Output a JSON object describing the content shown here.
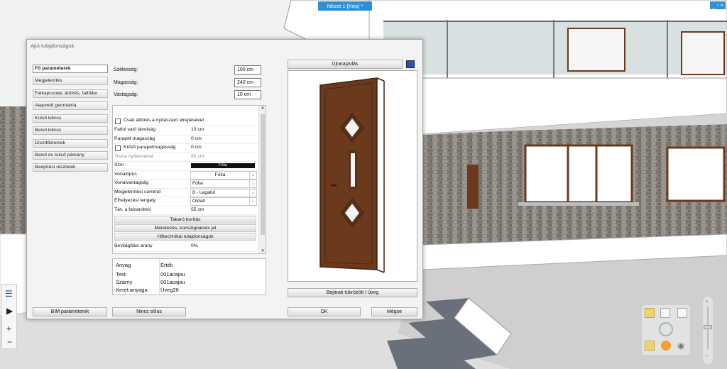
{
  "view_tab": "Nézet 1 [Kép] *",
  "window_controls": "_ ▫ ×",
  "dialog": {
    "title": "Ajtó tulajdonságok",
    "nav": [
      {
        "label": "Fő paraméterek",
        "active": true
      },
      {
        "label": "Megjelenítés"
      },
      {
        "label": "Falkapcsolat, áttörés, falfülke"
      },
      {
        "label": "Alapvető geometria"
      },
      {
        "label": "Külső kilincs"
      },
      {
        "label": "Belső kilincs"
      },
      {
        "label": "Díszítőelemek"
      },
      {
        "label": "Belső és külső párkány"
      },
      {
        "label": "Beépítési részletek"
      }
    ],
    "fields": [
      {
        "label": "Szélesség:",
        "value": "100 cm"
      },
      {
        "label": "Magasság:",
        "value": "240 cm"
      },
      {
        "label": "Vastagság:",
        "value": "10 cm"
      }
    ],
    "grid": {
      "checkbox1": "Csak áttörés a nyílászáró elrejtésével",
      "falto_label": "Faltól való távolság",
      "falto_value": "10 cm",
      "parapet_label": "Parapet magasság",
      "parapet_value": "0 cm",
      "kulso_label": "Külső parapetmagasság",
      "kulso_value": "0 cm",
      "tiszta_label": "Tiszta nyílásméret",
      "tiszta_value": "85 cm",
      "szin_label": "Szín",
      "szin_value": "Fólia",
      "szin_color": "#111111",
      "vonaltipus_label": "Vonaltípus",
      "vonaltipus_value": "Fólia",
      "vonalvastagsag_label": "Vonalvastagság",
      "vonalvastagsag_value": "Fólia",
      "megjsorrend_label": "Megjelenítési sorrend",
      "megjsorrend_value": "8 - Legalul",
      "elhelyezes_label": "Elhelyezési tengely",
      "elhelyezes_value": "Oldalt",
      "tav_label": "Táv. a falsaroktól",
      "tav_value": "55 cm",
      "header1": "Takaró borítás",
      "header2": "Méretezés, konszignációs jel",
      "header3": "Hőtechnikai tulajdonságok",
      "vilagitasi_label": "Bevilágítási arány",
      "vilagitasi_value": "0%"
    },
    "materials": {
      "col1": "Anyag",
      "col2": "Érték",
      "rows": [
        {
          "name": "Test:",
          "value": "001acajou"
        },
        {
          "name": "Szárny",
          "value": "001acajou"
        },
        {
          "name": "Keret anyaga",
          "value": "Üveg26"
        }
      ]
    },
    "redraw_button": "Újrarajzolás",
    "preview_caption_button": "Bejárati tükrözött I üveg",
    "bim_button": "BIM paraméterek",
    "style_button": "Nincs stílus",
    "ok_button": "OK",
    "cancel_button": "Mégse",
    "door_color": "#6b3a1c"
  },
  "left_toolbar": {
    "list_icon": "list-icon",
    "play_icon": "play-icon",
    "plus": "+",
    "minus": "−"
  }
}
